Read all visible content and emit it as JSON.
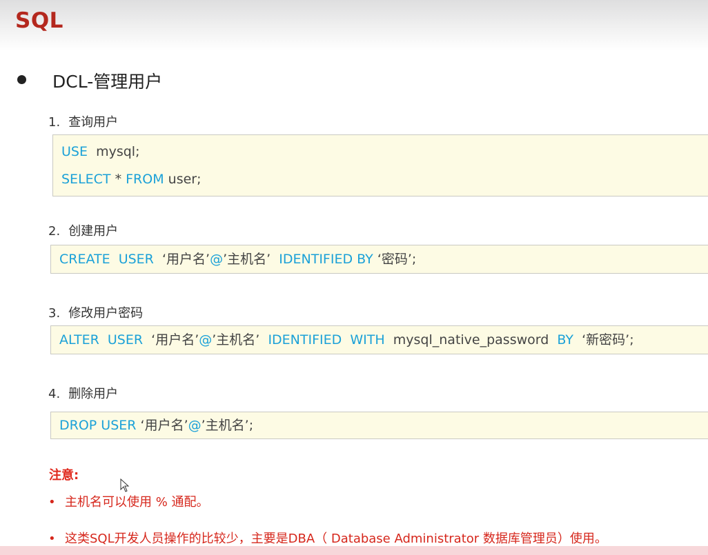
{
  "slide": {
    "title": "SQL"
  },
  "section": {
    "heading": "DCL-管理用户"
  },
  "steps": [
    {
      "number": "1.",
      "title": "查询用户"
    },
    {
      "number": "2.",
      "title": "创建用户"
    },
    {
      "number": "3.",
      "title": "修改用户密码"
    },
    {
      "number": "4.",
      "title": "删除用户"
    }
  ],
  "code": {
    "query_user": {
      "line1_kw": "USE",
      "line1_rest": "mysql;",
      "line2_kw1": "SELECT",
      "line2_mid": "*",
      "line2_kw2": "FROM",
      "line2_rest": "user;"
    },
    "create_user": {
      "kw1": "CREATE",
      "kw2": "USER",
      "user": "‘用户名’",
      "at": "@",
      "host": "’主机名’",
      "kw3": "IDENTIFIED",
      "kw4": "BY",
      "pwd": "‘密码’;"
    },
    "alter_user": {
      "kw1": "ALTER",
      "kw2": "USER",
      "user": "‘用户名’",
      "at": "@",
      "host": "’主机名’",
      "kw3": "IDENTIFIED",
      "kw4": "WITH",
      "plugin": "mysql_native_password",
      "kw5": "BY",
      "pwd": "‘新密码’;"
    },
    "drop_user": {
      "kw1": "DROP",
      "kw2": "USER",
      "user": "‘用户名’",
      "at": "@",
      "host": "’主机名’;"
    }
  },
  "notes": {
    "label": "注意:",
    "bullet": "•",
    "items": [
      "主机名可以使用 % 通配。",
      "这类SQL开发人员操作的比较少，主要是DBA（ Database Administrator 数据库管理员）使用。"
    ]
  },
  "colors": {
    "title": "#b4281e",
    "keyword": "#1ba1d8",
    "note": "#d6271c",
    "code_bg": "#fdfbe4"
  }
}
